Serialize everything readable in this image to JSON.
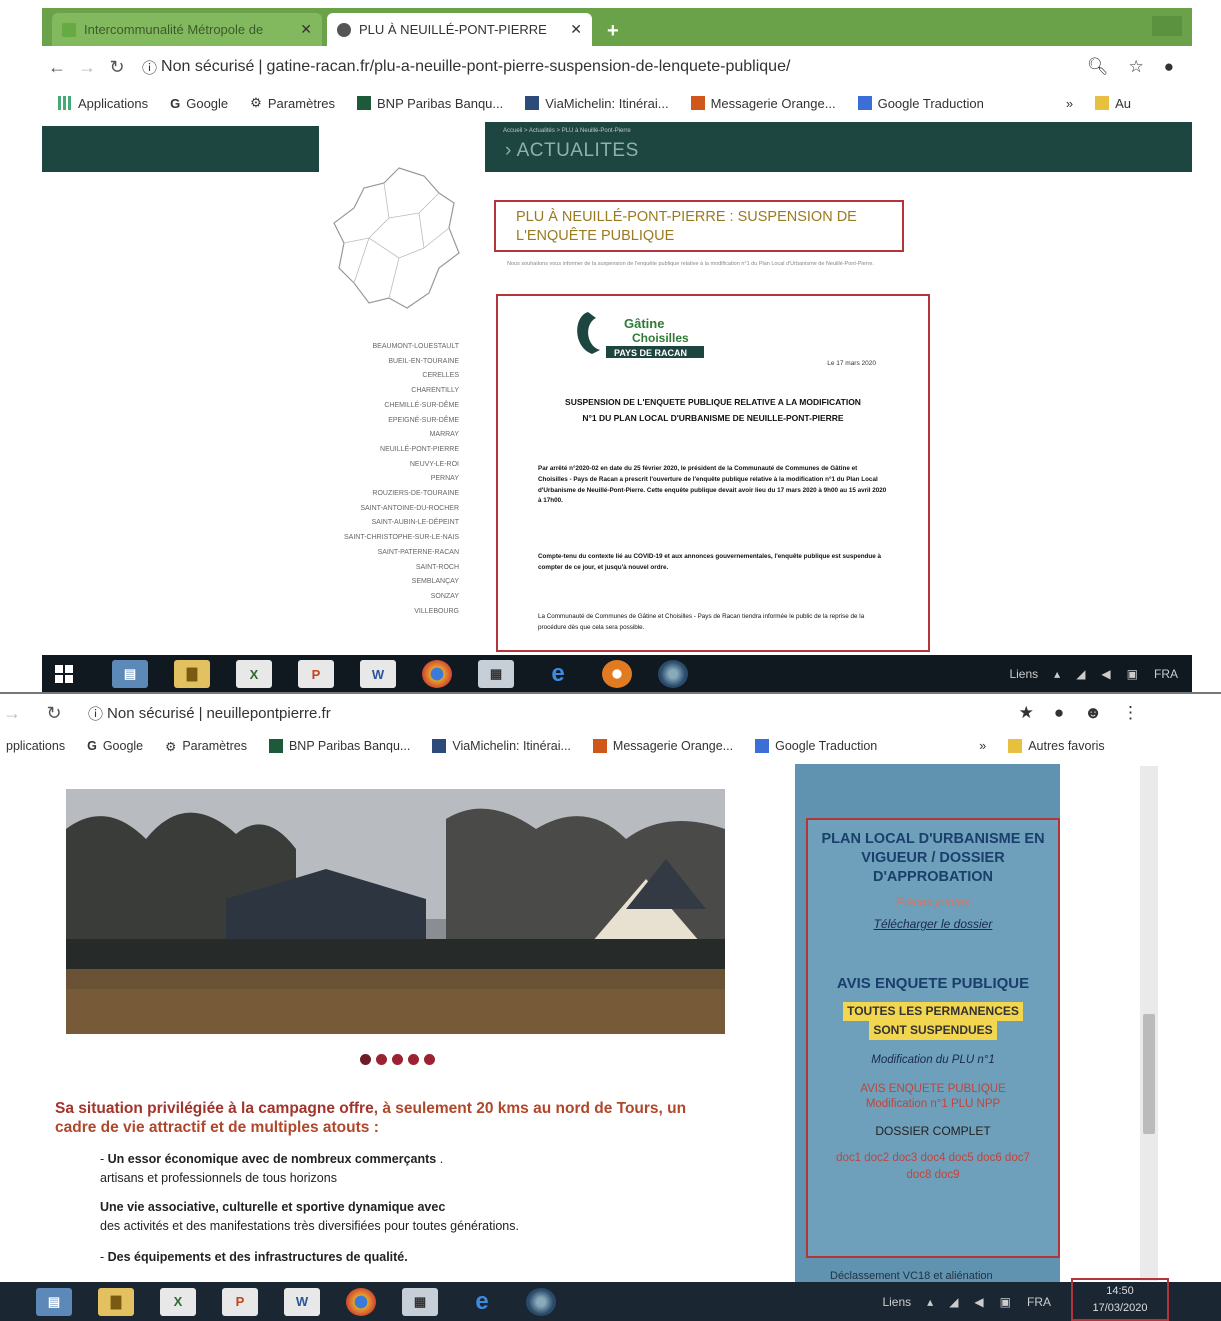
{
  "top": {
    "tabs": [
      {
        "label": "Intercommunalité Métropole de"
      },
      {
        "label": "PLU À NEUILLÉ-PONT-PIERRE"
      }
    ],
    "address": {
      "security": "Non sécurisé",
      "url": "gatine-racan.fr/plu-a-neuille-pont-pierre-suspension-de-lenquete-publique/"
    },
    "bookmarks": [
      {
        "label": "Applications",
        "icon": "apps-grid-icon"
      },
      {
        "label": "Google",
        "icon": "google-icon"
      },
      {
        "label": "Paramètres",
        "icon": "gear-icon"
      },
      {
        "label": "BNP Paribas Banqu...",
        "icon": "bnp-icon"
      },
      {
        "label": "ViaMichelin: Itinérai...",
        "icon": "viamichelin-icon"
      },
      {
        "label": "Messagerie Orange...",
        "icon": "orange-icon"
      },
      {
        "label": "Google Traduction",
        "icon": "translate-icon"
      },
      {
        "label": "Au",
        "icon": "folder-icon"
      }
    ],
    "section": "ACTUALITES",
    "post_title": "PLU À NEUILLÉ-PONT-PIERRE : SUSPENSION DE L'ENQUÊTE PUBLIQUE",
    "communes": [
      "BEAUMONT-LOUESTAULT",
      "BUEIL-EN-TOURAINE",
      "CERELLES",
      "CHARENTILLY",
      "CHEMILLÉ-SUR-DÊME",
      "EPEIGNÉ-SUR-DÊME",
      "MARRAY",
      "NEUILLÉ-PONT-PIERRE",
      "NEUVY-LE-ROI",
      "PERNAY",
      "ROUZIERS-DE-TOURAINE",
      "SAINT-ANTOINE-DU-ROCHER",
      "SAINT-AUBIN-LE-DÉPEINT",
      "SAINT-CHRISTOPHE-SUR-LE-NAIS",
      "SAINT-PATERNE-RACAN",
      "SAINT-ROCH",
      "SEMBLANÇAY",
      "SONZAY",
      "VILLEBOURG"
    ],
    "letter": {
      "logo_line1": "Gâtine",
      "logo_line2": "Choisilles",
      "logo_line3": "PAYS DE RACAN",
      "date": "Le 17 mars 2020",
      "title": "SUSPENSION DE L'ENQUETE PUBLIQUE RELATIVE A LA MODIFICATION N°1 DU PLAN LOCAL D'URBANISME DE NEUILLE-PONT-PIERRE",
      "p1": "Par arrêté n°2020-02 en date du 25 février 2020, le président de la Communauté de Communes de Gâtine et Choisilles - Pays de Racan a prescrit l'ouverture de l'enquête publique relative à la modification n°1 du Plan Local d'Urbanisme de Neuillé-Pont-Pierre. Cette enquête publique devait avoir lieu du 17 mars 2020 à 9h00 au 15 avril 2020 à 17h00.",
      "p2": "Compte-tenu du contexte lié au COVID-19 et aux annonces gouvernementales, l'enquête publique est suspendue à compter de ce jour, et jusqu'à nouvel ordre.",
      "p3": "La Communauté de Communes de Gâtine et Choisilles - Pays de Racan tiendra informée le public de la reprise de la procédure dès que cela sera possible."
    },
    "tray": {
      "links": "Liens",
      "lang": "FRA"
    }
  },
  "bottom": {
    "address": {
      "security": "Non sécurisé",
      "url": "neuillepontpierre.fr"
    },
    "bookmarks": [
      {
        "label": "pplications",
        "icon": "apps-grid-icon"
      },
      {
        "label": "Google",
        "icon": "google-icon"
      },
      {
        "label": "Paramètres",
        "icon": "gear-icon"
      },
      {
        "label": "BNP Paribas Banqu...",
        "icon": "bnp-icon"
      },
      {
        "label": "ViaMichelin: Itinérai...",
        "icon": "viamichelin-icon"
      },
      {
        "label": "Messagerie Orange...",
        "icon": "orange-icon"
      },
      {
        "label": "Google Traduction",
        "icon": "translate-icon"
      },
      {
        "label": "Autres favoris",
        "icon": "folder-icon"
      }
    ],
    "lead_highlight": "Sa situation privilégiée à la campagne offre",
    "lead_rest": ", à seulement 20 kms au nord de Tours, un cadre de vie attractif et de multiples atouts :",
    "bullet1_bold": "Un essor économique avec de nombreux commerçants",
    "bullet1_rest": "artisans et professionnels de tous horizons",
    "bullet2_bold": "Une vie associative, culturelle et sportive dynamique avec",
    "bullet2_rest": "des activités et des manifestations très diversifiées pour toutes générations.",
    "bullet3_bold": "Des équipements et des infrastructures de qualité.",
    "sidebar": {
      "plu_title": "PLAN LOCAL D'URBANISME EN VIGUEUR / DOSSIER D'APPROBATION",
      "link1": "Pièces jointes",
      "link2": "Télécharger le dossier",
      "avis_title": "AVIS ENQUETE PUBLIQUE",
      "highlight1": "TOUTES LES PERMANENCES",
      "highlight2": "SONT SUSPENDUES",
      "modification": "Modification du PLU n°1",
      "avis_line1": "AVIS ENQUETE PUBLIQUE",
      "avis_line2": "Modification n°1 PLU NPP",
      "dossier": "DOSSIER COMPLET",
      "docs": "doc1 doc2 doc3 doc4 doc5 doc6 doc7 doc8 doc9",
      "bottom_text": "Déclassement VC18 et aliénation"
    },
    "tray": {
      "links": "Liens",
      "lang": "FRA",
      "time": "14:50",
      "date": "17/03/2020"
    }
  },
  "colors": {
    "frame_red": "#b2353a",
    "tab_green": "#6aa24a",
    "site_teal": "#1e4640",
    "sidebar_blue": "#5f93b0",
    "lead_orange": "#b0472b"
  }
}
